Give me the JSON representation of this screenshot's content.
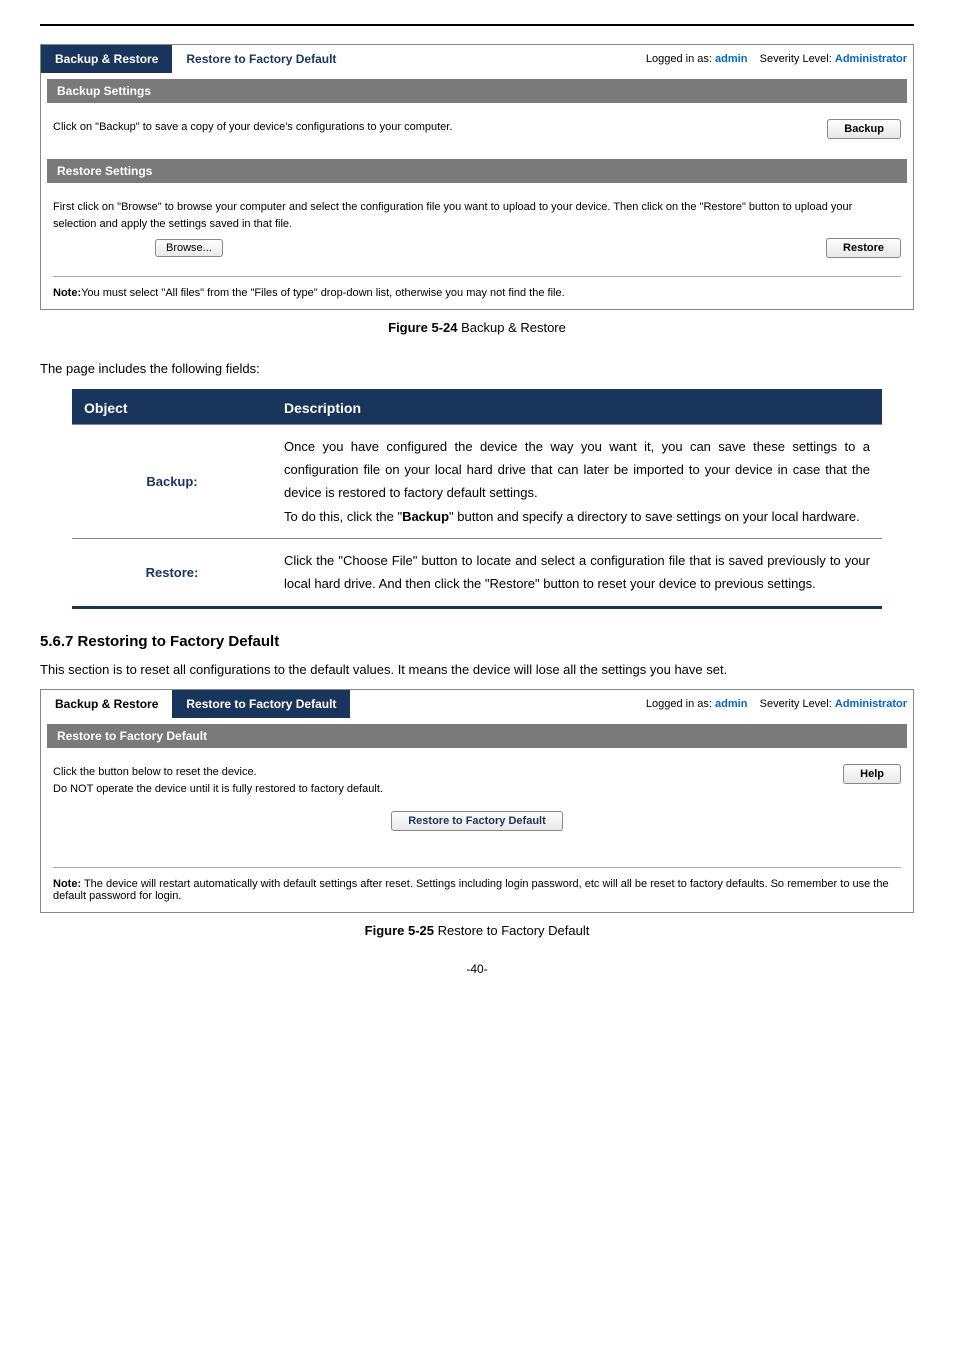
{
  "panel1": {
    "tabs": {
      "inactive": "Backup & Restore",
      "active": "Restore to Factory Default"
    },
    "login": {
      "label1": "Logged in as:",
      "val1": "admin",
      "label2": "Severity Level:",
      "val2": "Administrator"
    },
    "backupBar": "Backup Settings",
    "backupText": "Click on \"Backup\" to save a copy of your device's configurations to your computer.",
    "backupBtn": "Backup",
    "restoreBar": "Restore Settings",
    "restoreText": "First click on \"Browse\" to browse your computer and select the configuration file you want to upload to your device. Then click on the \"Restore\" button to    upload your selection and apply the settings saved in that file.",
    "browseBtn": "Browse...",
    "restoreBtn": "Restore",
    "notePrefix": "Note:",
    "noteText": "You must select \"All files\" from the \"Files of type\" drop-down list, otherwise you may not find the file."
  },
  "fig1": {
    "label": "Figure 5-24",
    "text": " Backup & Restore"
  },
  "intro1": "The page includes the following fields:",
  "table": {
    "h1": "Object",
    "h2": "Description",
    "rows": [
      {
        "obj": "Backup:",
        "desc_parts": [
          "Once you have configured the device the way you want it, you can save these settings to a configuration file on your local hard drive that can later be imported to your device in case that the device is restored to factory default settings.",
          "To do this, click the \"",
          "Backup",
          "\" button and specify a directory to save settings on your local hardware."
        ]
      },
      {
        "obj": "Restore:",
        "desc": "Click the \"Choose File\" button to locate and select a configuration file that is saved previously to your local hard drive. And then click the \"Restore\" button to reset your device to previous settings."
      }
    ]
  },
  "heading567": "5.6.7  Restoring to Factory Default",
  "intro2": "This section is to reset all configurations to the default values. It means the device will lose all the settings you have set.",
  "panel2": {
    "tabs": {
      "inactive": "Backup & Restore",
      "active": "Restore to Factory Default"
    },
    "login": {
      "label1": "Logged in as:",
      "val1": "admin",
      "label2": "Severity Level:",
      "val2": "Administrator"
    },
    "bar": "Restore to Factory Default",
    "text": "Click the button below to reset the device.\nDo NOT operate the device until it is fully restored to factory default.",
    "helpBtn": "Help",
    "mainBtn": "Restore to Factory Default",
    "notePrefix": "Note:",
    "noteText": "  The device will restart automatically with default settings after reset. Settings including login password, etc will all be reset to factory defaults. So remember to use the default password for login."
  },
  "fig2": {
    "label": "Figure 5-25",
    "text": " Restore to Factory Default"
  },
  "pageNum": "-40-"
}
